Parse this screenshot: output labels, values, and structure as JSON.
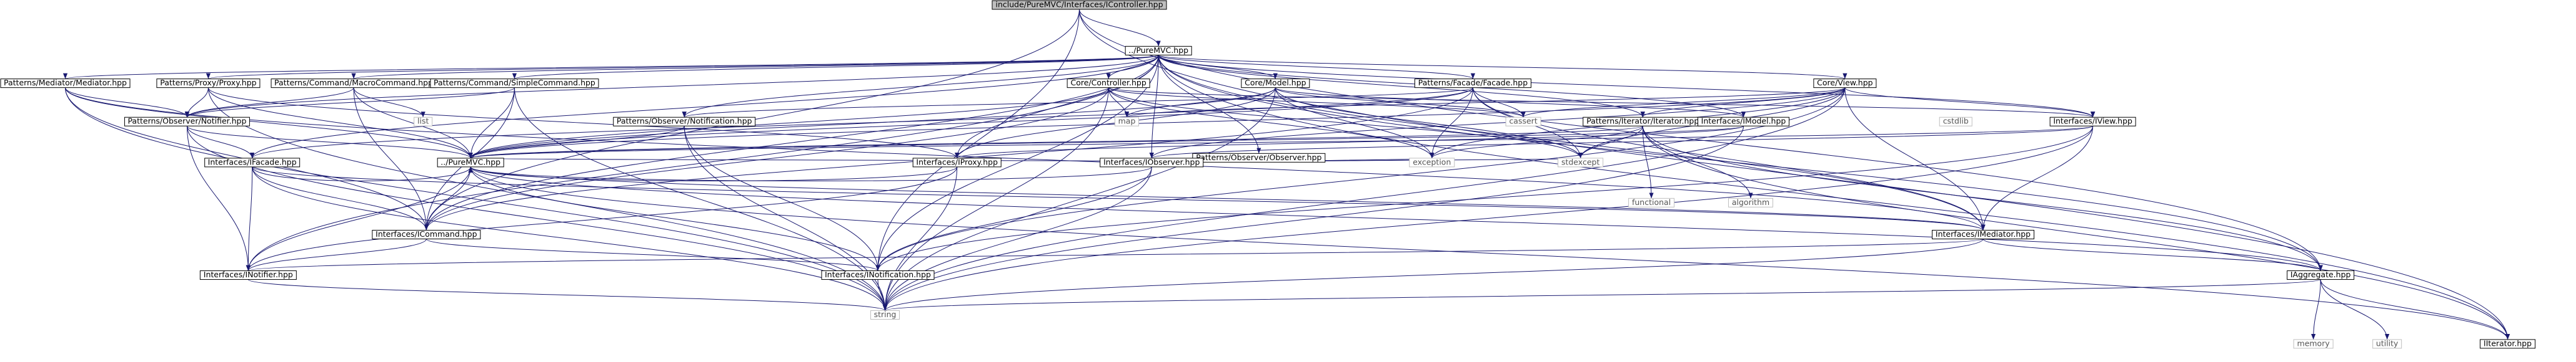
{
  "graph": {
    "edge_color": "#191970",
    "root_fill": "#bfbfbf",
    "system_header_border": "#bfbfbf",
    "nodes": {
      "icontroller": "include/PureMVC/Interfaces/IController.hpp",
      "puremvc_top": "../PureMVC.hpp",
      "mediator": "Patterns/Mediator/Mediator.hpp",
      "proxy": "Patterns/Proxy/Proxy.hpp",
      "macrocommand": "Patterns/Command/MacroCommand.hpp",
      "simplecommand": "Patterns/Command/SimpleCommand.hpp",
      "controller": "Core/Controller.hpp",
      "model": "Core/Model.hpp",
      "facade": "Patterns/Facade/Facade.hpp",
      "view": "Core/View.hpp",
      "observernotifier": "Patterns/Observer/Notifier.hpp",
      "list": "list",
      "notification": "Patterns/Observer/Notification.hpp",
      "map": "map",
      "cassert": "cassert",
      "observer": "Patterns/Observer/Observer.hpp",
      "iterator": "Patterns/Iterator/Iterator.hpp",
      "imodel": "Interfaces/IModel.hpp",
      "cstdlib": "cstdlib",
      "iview": "Interfaces/IView.hpp",
      "ifacade": "Interfaces/IFacade.hpp",
      "puremvc_mid": "../PureMVC.hpp",
      "iproxy": "Interfaces/IProxy.hpp",
      "iobserver": "Interfaces/IObserver.hpp",
      "exception": "exception",
      "stdexcept": "stdexcept",
      "functional": "functional",
      "algorithm": "algorithm",
      "icommand": "Interfaces/ICommand.hpp",
      "imediator": "Interfaces/IMediator.hpp",
      "inotifier": "Interfaces/INotifier.hpp",
      "inotification": "Interfaces/INotification.hpp",
      "iaggregate": "IAggregate.hpp",
      "string": "string",
      "memory": "memory",
      "utility": "utility",
      "iiterator": "IIterator.hpp"
    }
  }
}
